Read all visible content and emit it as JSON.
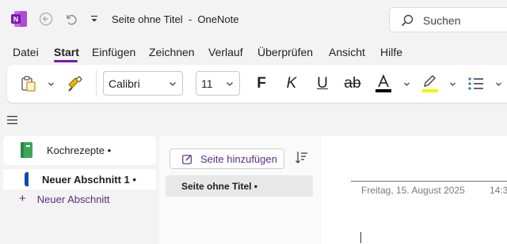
{
  "titlebar": {
    "app_icon": "onenote-logo-icon",
    "title": "Seite ohne Titel  -  OneNote",
    "search_label": "Suchen"
  },
  "menu": {
    "tabs": [
      "Datei",
      "Start",
      "Einfügen",
      "Zeichnen",
      "Verlauf",
      "Überprüfen",
      "Ansicht",
      "Hilfe"
    ],
    "active_tab": "Start"
  },
  "ribbon": {
    "font_name": "Calibri",
    "font_size": "11",
    "bold_label": "F",
    "italic_label": "K",
    "underline_label": "U",
    "strike_label": "ab",
    "font_color_label": "A",
    "font_color": "#000000",
    "highlight_color": "#f2f200"
  },
  "notebook": {
    "name": "Kochrezepte •",
    "section": "Neuer Abschnitt 1 •",
    "section_color": "#0a4ea6",
    "add_section": "Neuer Abschnitt"
  },
  "pages": {
    "add_page": "Seite hinzufügen",
    "items": [
      "Seite ohne Titel •"
    ]
  },
  "content": {
    "date": "Freitag, 15. August 2025",
    "time": "14:3"
  },
  "colors": {
    "accent": "#7719aa",
    "link": "#5a2d82"
  }
}
